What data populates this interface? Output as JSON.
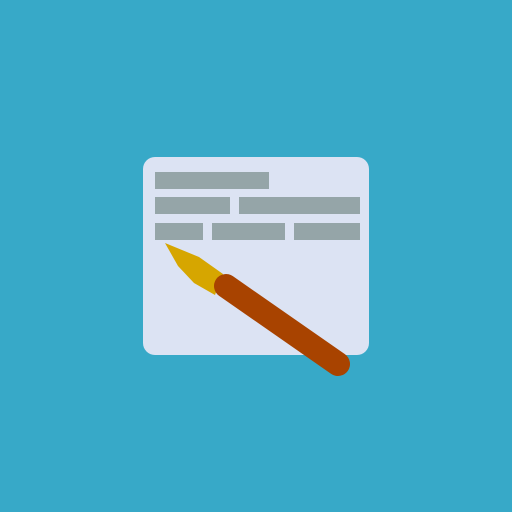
{
  "icon": {
    "semantic": "write-document-with-pen-icon",
    "colors": {
      "background": "#37A9C8",
      "document": "#DCE3F3",
      "text_lines": "#95A5A8",
      "pen_nib": "#D6A600",
      "pen_body": "#A84300"
    }
  }
}
